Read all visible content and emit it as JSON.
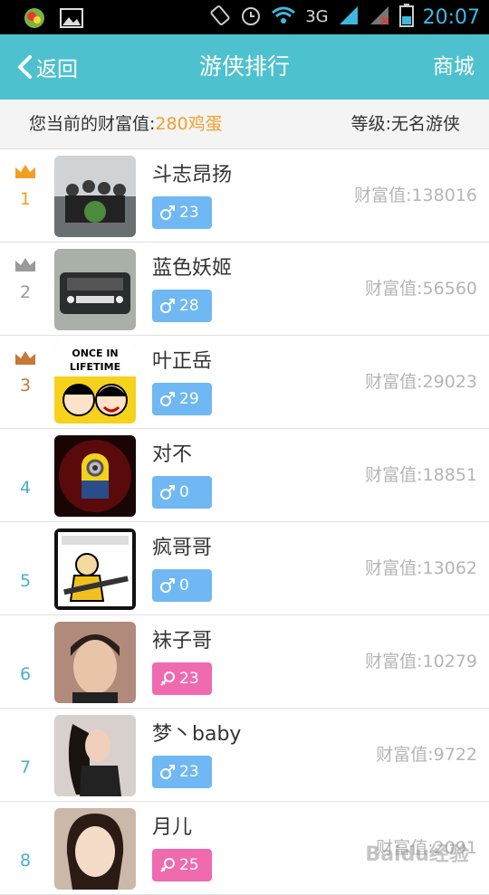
{
  "status_bar": {
    "time": "20:07",
    "network": "3G",
    "sim1": "1",
    "sim2": "2",
    "icons": [
      "app-icon",
      "image-icon",
      "rotate-icon",
      "alarm-icon",
      "wifi-icon",
      "signal-icon",
      "signal-icon-2",
      "battery-icon"
    ]
  },
  "header": {
    "back_label": "返回",
    "title": "游侠排行",
    "mall_label": "商城",
    "bg_color": "#4ec1cf"
  },
  "wealth_summary": {
    "label": "您当前的财富值:",
    "value": "280鸡蛋",
    "level": "等级:无名游侠"
  },
  "rankings": [
    {
      "rank": "1",
      "crown": "gold",
      "name": "斗志昂扬",
      "gender": "male",
      "age": "23",
      "wealth": "财富值:138016"
    },
    {
      "rank": "2",
      "crown": "silver",
      "name": "蓝色妖姬",
      "gender": "male",
      "age": "28",
      "wealth": "财富值:56560"
    },
    {
      "rank": "3",
      "crown": "bronze",
      "name": "叶正岳",
      "gender": "male",
      "age": "29",
      "wealth": "财富值:29023"
    },
    {
      "rank": "4",
      "crown": "none",
      "name": "对不",
      "gender": "male",
      "age": "0",
      "wealth": "财富值:18851"
    },
    {
      "rank": "5",
      "crown": "none",
      "name": "疯哥哥",
      "gender": "male",
      "age": "0",
      "wealth": "财富值:13062"
    },
    {
      "rank": "6",
      "crown": "none",
      "name": "袜子哥",
      "gender": "female",
      "age": "23",
      "wealth": "财富值:10279"
    },
    {
      "rank": "7",
      "crown": "none",
      "name": "梦丶baby",
      "gender": "male",
      "age": "23",
      "wealth": "财富值:9722"
    },
    {
      "rank": "8",
      "crown": "none",
      "name": "月儿",
      "gender": "female",
      "age": "25",
      "wealth": "财富值:2091"
    }
  ],
  "avatar_texts": {
    "row3": "ONCE IN LIFETIME"
  },
  "colors": {
    "gold": "#f0a020",
    "silver": "#9a9a9a",
    "bronze": "#c8763a",
    "plain_rank": "#4ab0c8",
    "male_badge": "#6fb8f3",
    "female_badge": "#f06ab0"
  },
  "watermark": "Baidu经验"
}
